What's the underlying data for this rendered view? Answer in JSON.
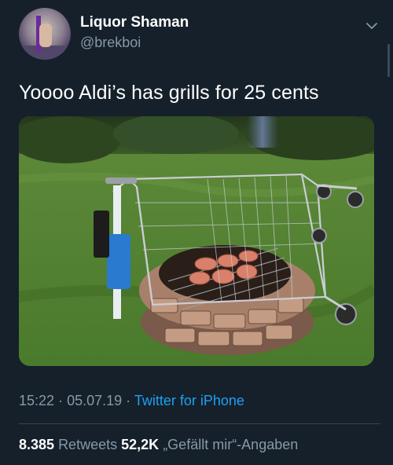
{
  "tweet": {
    "display_name": "Liquor Shaman",
    "handle": "@brekboi",
    "text": "Yoooo Aldi’s has grills for 25 cents",
    "time": "15:22",
    "dot": "·",
    "date": "05.07.19",
    "source": "Twitter for iPhone",
    "retweets_count": "8.385",
    "retweets_label": "Retweets",
    "likes_count": "52,2K",
    "likes_label": "„Gefällt mir“-Angaben"
  },
  "icons": {
    "menu": "chevron-down-icon"
  },
  "colors": {
    "background": "#15202b",
    "secondary_text": "#8899a6",
    "link": "#1da1f2",
    "divider": "#38444d"
  }
}
